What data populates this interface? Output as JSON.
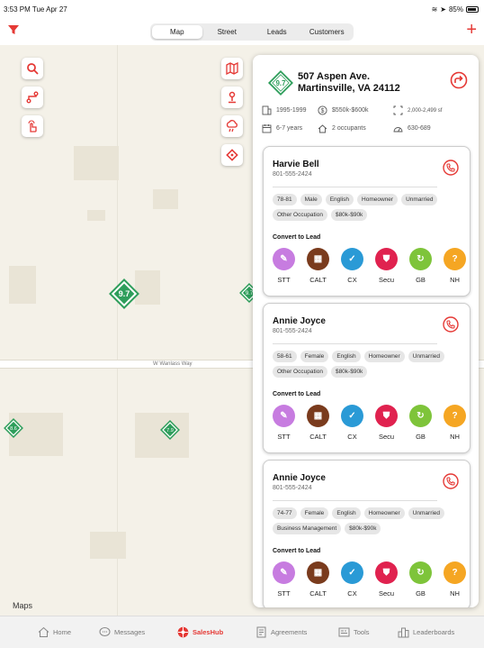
{
  "status_bar": {
    "time": "3:53 PM  Tue Apr 27",
    "battery": "85%"
  },
  "header": {
    "tabs": [
      {
        "label": "Map",
        "active": true
      },
      {
        "label": "Street",
        "active": false
      },
      {
        "label": "Leads",
        "active": false
      },
      {
        "label": "Customers",
        "active": false
      }
    ]
  },
  "map": {
    "road_name": "W Wanlass Way",
    "logo": "Maps",
    "pins": [
      "9.7",
      "9.7",
      "8.6",
      "7.9"
    ]
  },
  "property": {
    "score": "9.7",
    "address_line1": "507 Aspen Ave.",
    "address_line2": "Martinsville, VA 24112",
    "year_built": "1995-1999",
    "value": "$550k-$600k",
    "sqft": "2,000-2,499 sf",
    "residence": "6-7 years",
    "occupants": "2 occupants",
    "credit": "630-689"
  },
  "convert_label": "Convert to Lead",
  "lead_types": [
    {
      "label": "STT",
      "color": "#c77ce0",
      "icon": "tool-icon",
      "glyph": "✎"
    },
    {
      "label": "CALT",
      "color": "#7a3b1d",
      "icon": "calendar-icon",
      "glyph": "▦"
    },
    {
      "label": "CX",
      "color": "#2a9ad6",
      "icon": "check-icon",
      "glyph": "✓"
    },
    {
      "label": "Secu",
      "color": "#e0224f",
      "icon": "shield-icon",
      "glyph": "⛊"
    },
    {
      "label": "GB",
      "color": "#7ec43a",
      "icon": "recycle-icon",
      "glyph": "↻"
    },
    {
      "label": "NH",
      "color": "#f5a623",
      "icon": "question-icon",
      "glyph": "?"
    }
  ],
  "contacts": [
    {
      "name": "Harvie Bell",
      "phone": "801-555-2424",
      "tags": [
        "78-81",
        "Male",
        "English",
        "Homeowner",
        "Unmarried",
        "Other Occupation",
        "$80k-$90k"
      ]
    },
    {
      "name": "Annie Joyce",
      "phone": "801-555-2424",
      "tags": [
        "58-61",
        "Female",
        "English",
        "Homeowner",
        "Unmarried",
        "Other Occupation",
        "$80k-$90k"
      ]
    },
    {
      "name": "Annie Joyce",
      "phone": "801-555-2424",
      "tags": [
        "74-77",
        "Female",
        "English",
        "Homeowner",
        "Unmarried",
        "Business Management",
        "$80k-$90k"
      ]
    }
  ],
  "tab_bar": [
    {
      "label": "Home",
      "icon": "home-icon",
      "active": false
    },
    {
      "label": "Messages",
      "icon": "chat-icon",
      "active": false
    },
    {
      "label": "SalesHub",
      "icon": "saleshub-icon",
      "active": true
    },
    {
      "label": "Agreements",
      "icon": "document-icon",
      "active": false
    },
    {
      "label": "Tools",
      "icon": "tools-icon",
      "active": false
    },
    {
      "label": "Leaderboards",
      "icon": "leaderboard-icon",
      "active": false
    }
  ],
  "colors": {
    "accent": "#e53935",
    "score_green": "#2e9e5b"
  }
}
